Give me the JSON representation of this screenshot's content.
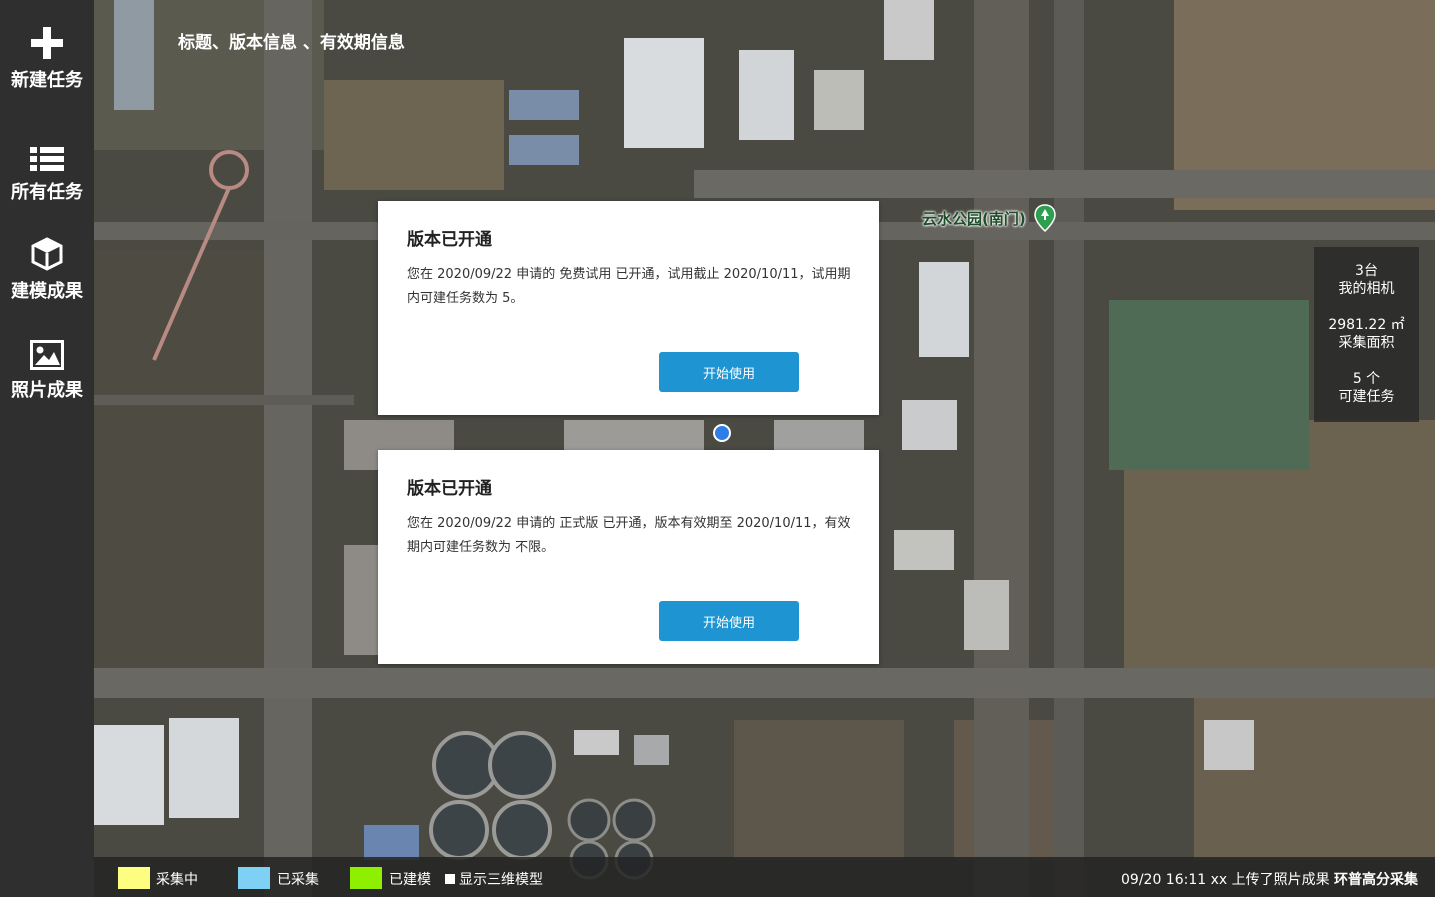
{
  "sidebar": {
    "items": [
      {
        "label": "新建任务",
        "icon": "plus-icon"
      },
      {
        "label": "所有任务",
        "icon": "list-icon"
      },
      {
        "label": "建模成果",
        "icon": "cube-icon"
      },
      {
        "label": "照片成果",
        "icon": "image-icon"
      }
    ]
  },
  "header": {
    "title": "标题、版本信息 、有效期信息"
  },
  "map": {
    "poi_label": "云水公园(南门)",
    "poi_icon": "park-pin-icon"
  },
  "dialogs": [
    {
      "title": "版本已开通",
      "body": "您在 2020/09/22 申请的 免费试用 已开通，试用截止 2020/10/11，试用期内可建任务数为 5。",
      "button": "开始使用"
    },
    {
      "title": "版本已开通",
      "body": "您在 2020/09/22 申请的 正式版 已开通，版本有效期至 2020/10/11，有效期内可建任务数为 不限。",
      "button": "开始使用"
    }
  ],
  "stats": {
    "cameras_value": "3台",
    "cameras_label": "我的相机",
    "area_value": "2981.22 ㎡",
    "area_label": "采集面积",
    "tasks_value": "5 个",
    "tasks_label": "可建任务"
  },
  "bottombar": {
    "legend": [
      {
        "label": "采集中",
        "color": "#fdfd80"
      },
      {
        "label": "已采集",
        "color": "#7ed0f5"
      },
      {
        "label": "已建模",
        "color": "#8ef000"
      }
    ],
    "show3d_label": "显示三维模型",
    "activity": "09/20 16:11   xx 上传了照片成果",
    "brand": "环普高分采集"
  }
}
